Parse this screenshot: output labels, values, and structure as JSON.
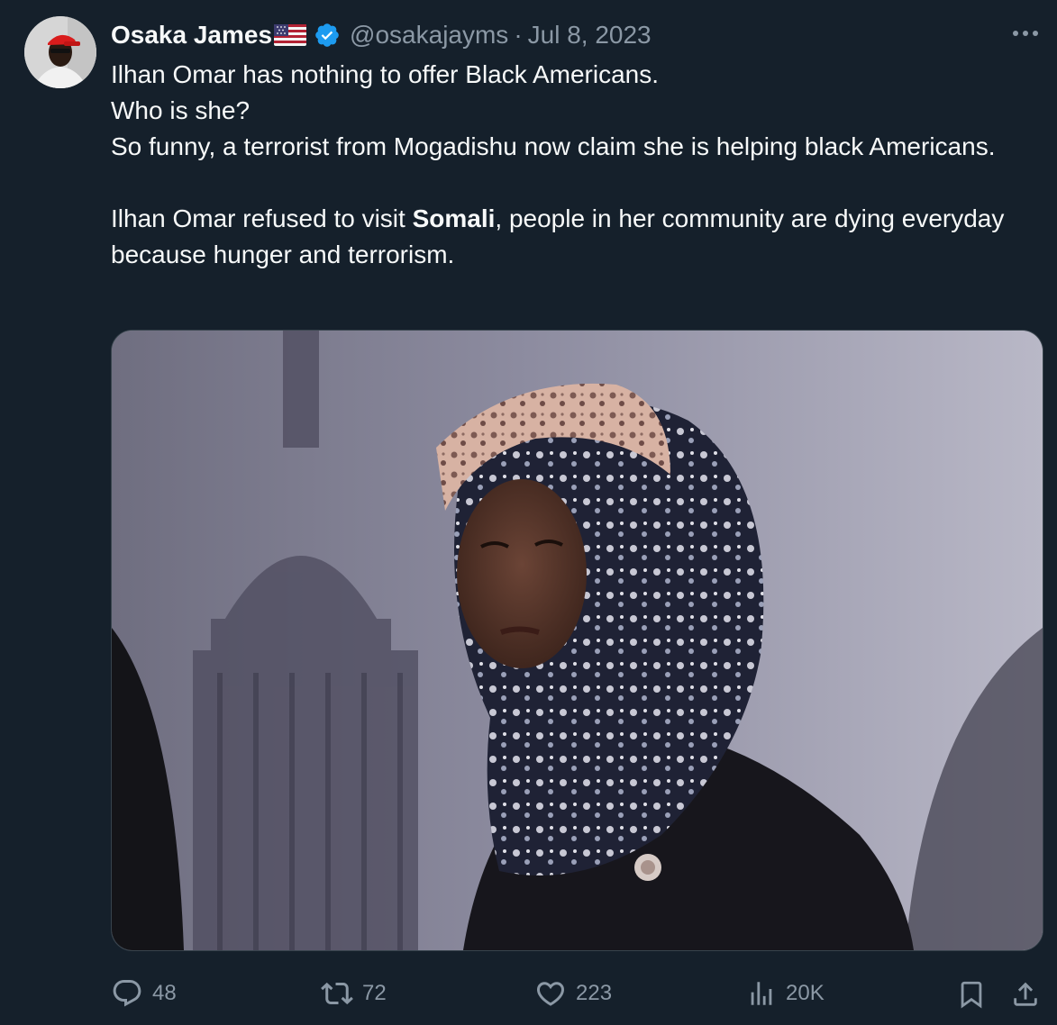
{
  "author": {
    "name": "Osaka James",
    "flag": "us-flag-emoji",
    "verified": true,
    "handle": "@osakajayms",
    "separator": "·",
    "date": "Jul 8, 2023"
  },
  "tweet": {
    "lines": [
      "Ilhan Omar has nothing to offer Black Americans.",
      "Who is she?",
      "So funny, a terrorist  from Mogadishu now claim she is helping black Americans."
    ],
    "para2": {
      "before": "Ilhan Omar refused to visit ",
      "bold": "Somali",
      "after": ", people in her community are dying everyday because hunger and terrorism."
    }
  },
  "media": {
    "icon": "photo"
  },
  "actions": {
    "replies": "48",
    "reposts": "72",
    "likes": "223",
    "views": "20K"
  },
  "colors": {
    "background": "#15202b",
    "text": "#f7f9f9",
    "muted": "#8b98a5",
    "verified": "#1d9bf0",
    "border": "#38444d"
  },
  "icons": {
    "more": "more-icon",
    "reply": "reply-icon",
    "repost": "repost-icon",
    "like": "heart-icon",
    "views": "analytics-icon",
    "bookmark": "bookmark-icon",
    "share": "share-icon"
  }
}
